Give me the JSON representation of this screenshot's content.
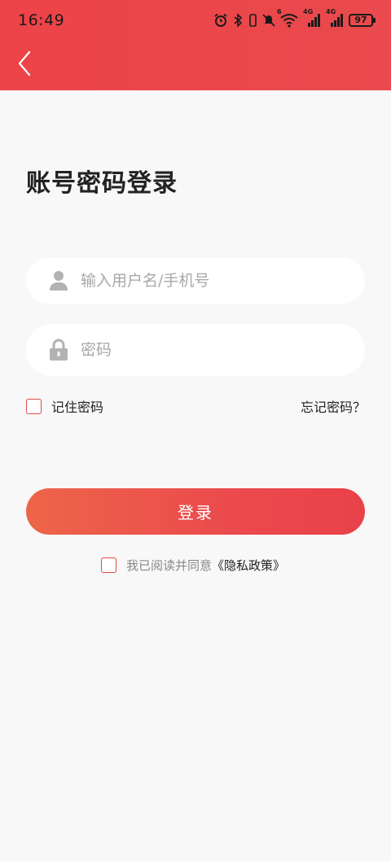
{
  "status_bar": {
    "time": "16:49",
    "battery": "97",
    "network_1": "4G",
    "network_2": "4G",
    "wifi_badge": "6"
  },
  "header": {
    "back_icon": "chevron-left-icon",
    "background_color": "#ec4347"
  },
  "page": {
    "title": "账号密码登录"
  },
  "form": {
    "username": {
      "icon": "user-icon",
      "placeholder": "输入用户名/手机号",
      "value": ""
    },
    "password": {
      "icon": "lock-icon",
      "placeholder": "密码",
      "value": ""
    },
    "remember_label": "记住密码",
    "remember_checked": false,
    "forgot_label": "忘记密码？"
  },
  "login_button": {
    "label": "登录",
    "color": "#eb4a4d"
  },
  "agreement": {
    "text": "我已阅读并同意",
    "link": "《隐私政策》",
    "checked": false
  }
}
